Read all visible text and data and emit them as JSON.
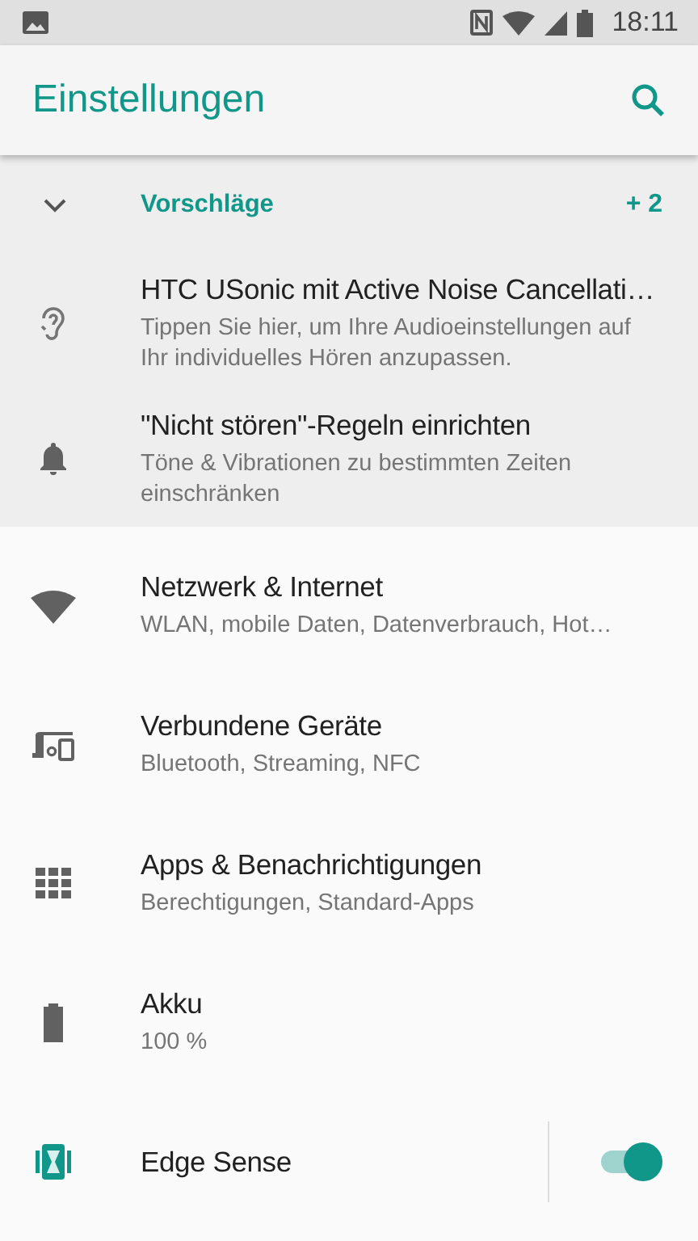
{
  "status_bar": {
    "time": "18:11"
  },
  "app_bar": {
    "title": "Einstellungen"
  },
  "suggestions": {
    "title": "Vorschläge",
    "count": "+ 2",
    "expanded": true,
    "items": [
      {
        "title": "HTC USonic mit Active Noise Cancellati…",
        "summary": "Tippen Sie hier, um Ihre Audioeinstellungen auf Ihr individuelles Hören anzupassen."
      },
      {
        "title": "\"Nicht stören\"-Regeln einrichten",
        "summary": "Töne & Vibrationen zu bestimmten Zeiten einschränken"
      }
    ]
  },
  "settings": [
    {
      "kind": "link",
      "title": "Netzwerk & Internet",
      "summary": "WLAN, mobile Daten, Datenverbrauch, Hot…"
    },
    {
      "kind": "link",
      "title": "Verbundene Geräte",
      "summary": "Bluetooth, Streaming, NFC"
    },
    {
      "kind": "link",
      "title": "Apps & Benachrichtigungen",
      "summary": "Berechtigungen, Standard-Apps"
    },
    {
      "kind": "link",
      "title": "Akku",
      "summary": "100 %"
    },
    {
      "kind": "switch",
      "title": "Edge Sense",
      "on": true
    }
  ]
}
